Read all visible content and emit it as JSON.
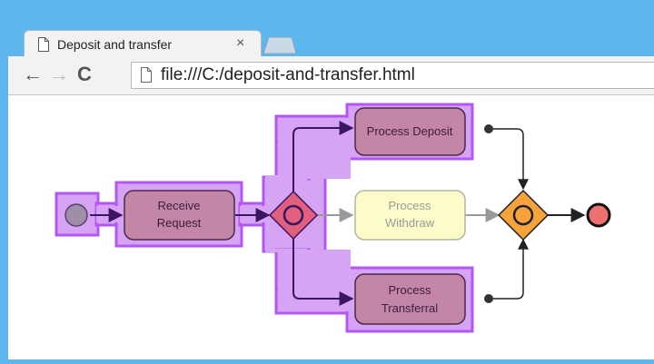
{
  "browser": {
    "tab_title": "Deposit and transfer",
    "tab_close": "×",
    "url": "file:///C:/deposit-and-transfer.html",
    "back": "←",
    "forward": "→",
    "reload": "C"
  },
  "diagram": {
    "tasks": {
      "receive_request": [
        "Receive",
        "Request"
      ],
      "process_deposit": [
        "Process Deposit"
      ],
      "process_withdraw": [
        "Process",
        "Withdraw"
      ],
      "process_transferral": [
        "Process",
        "Transferral"
      ]
    },
    "colors": {
      "highlight": "#d6a3f5",
      "highlight_border": "#b257f2",
      "task_fill": "#c386a6",
      "task_inactive_fill": "#fbfcc9",
      "gateway_exclusive_fill": "#e0607e",
      "gateway_inclusive_fill": "#f7a23a",
      "end_event_fill": "#ee7172",
      "start_event_fill": "#9e8fa6",
      "active_flow": "#3a1660",
      "inactive_flow": "#999999",
      "join_flow": "#222222"
    }
  }
}
